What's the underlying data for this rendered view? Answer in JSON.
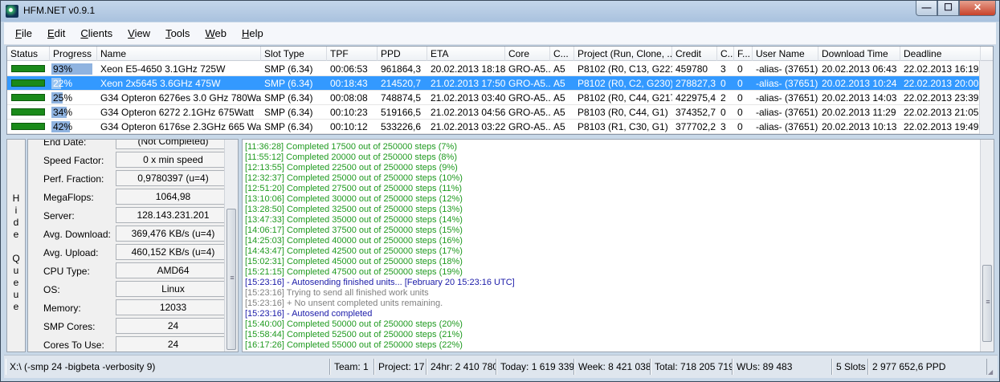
{
  "window": {
    "title": "HFM.NET v0.9.1",
    "min_glyph": "—",
    "max_glyph": "☐",
    "close_glyph": "✕"
  },
  "menu": [
    "File",
    "Edit",
    "Clients",
    "View",
    "Tools",
    "Web",
    "Help"
  ],
  "grid": {
    "columns": [
      "Status",
      "Progress",
      "Name",
      "Slot Type",
      "TPF",
      "PPD",
      "ETA",
      "Core",
      "C...",
      "Project (Run, Clone, ...",
      "Credit",
      "C...",
      "F...",
      "User Name",
      "Download Time",
      "Deadline"
    ],
    "rows": [
      {
        "progress": "93%",
        "progress_value": 0.93,
        "name": "Xeon E5-4650 3.1GHz 725W",
        "slot_type": "SMP (6.34)",
        "tpf": "00:06:53",
        "ppd": "961864,3",
        "eta": "20.02.2013 18:18",
        "core": "GRO-A5...",
        "core_id": "A5",
        "project": "P8102 (R0, C13, G221)",
        "credit": "459780",
        "completed": "3",
        "failed": "0",
        "user": "-alias- (37651)",
        "download": "20.02.2013 06:43",
        "deadline": "22.02.2013 16:19",
        "selected": false
      },
      {
        "progress": "22%",
        "progress_value": 0.22,
        "name": "Xeon 2x5645 3.6GHz 475W",
        "slot_type": "SMP (6.34)",
        "tpf": "00:18:43",
        "ppd": "214520,7",
        "eta": "21.02.2013 17:50",
        "core": "GRO-A5...",
        "core_id": "A5",
        "project": "P8102 (R0, C2, G230)",
        "credit": "278827,3",
        "completed": "0",
        "failed": "0",
        "user": "-alias- (37651)",
        "download": "20.02.2013 10:24",
        "deadline": "22.02.2013 20:00",
        "selected": true
      },
      {
        "progress": "25%",
        "progress_value": 0.25,
        "name": "G34 Opteron 6276es 3.0 GHz 780Watt",
        "slot_type": "SMP (6.34)",
        "tpf": "00:08:08",
        "ppd": "748874,5",
        "eta": "21.02.2013 03:40",
        "core": "GRO-A5...",
        "core_id": "A5",
        "project": "P8102 (R0, C44, G217)",
        "credit": "422975,4",
        "completed": "2",
        "failed": "0",
        "user": "-alias- (37651)",
        "download": "20.02.2013 14:03",
        "deadline": "22.02.2013 23:39",
        "selected": false
      },
      {
        "progress": "34%",
        "progress_value": 0.34,
        "name": "G34 Opteron 6272 2.1GHz 675Watt",
        "slot_type": "SMP (6.34)",
        "tpf": "00:10:23",
        "ppd": "519166,5",
        "eta": "21.02.2013 04:56",
        "core": "GRO-A5...",
        "core_id": "A5",
        "project": "P8103 (R0, C44, G1)",
        "credit": "374352,7",
        "completed": "0",
        "failed": "0",
        "user": "-alias- (37651)",
        "download": "20.02.2013 11:29",
        "deadline": "22.02.2013 21:05",
        "selected": false
      },
      {
        "progress": "42%",
        "progress_value": 0.42,
        "name": "G34 Opteron 6176se 2.3GHz 665 Watt",
        "slot_type": "SMP (6.34)",
        "tpf": "00:10:12",
        "ppd": "533226,6",
        "eta": "21.02.2013 03:22",
        "core": "GRO-A5...",
        "core_id": "A5",
        "project": "P8103 (R1, C30, G1)",
        "credit": "377702,2",
        "completed": "3",
        "failed": "0",
        "user": "-alias- (37651)",
        "download": "20.02.2013 10:13",
        "deadline": "22.02.2013 19:49",
        "selected": false
      }
    ]
  },
  "queue_toggle": {
    "label": "Hide Queue"
  },
  "info": [
    {
      "label": "End Date:",
      "value": "(Not Completed)"
    },
    {
      "label": "Speed Factor:",
      "value": "0 x min speed"
    },
    {
      "label": "Perf. Fraction:",
      "value": "0,9780397 (u=4)"
    },
    {
      "label": "MegaFlops:",
      "value": "1064,98"
    },
    {
      "label": "Server:",
      "value": "128.143.231.201"
    },
    {
      "label": "Avg. Download:",
      "value": "369,476 KB/s (u=4)"
    },
    {
      "label": "Avg. Upload:",
      "value": "460,152 KB/s (u=4)"
    },
    {
      "label": "CPU Type:",
      "value": "AMD64"
    },
    {
      "label": "OS:",
      "value": "Linux"
    },
    {
      "label": "Memory:",
      "value": "12033"
    },
    {
      "label": "SMP Cores:",
      "value": "24"
    },
    {
      "label": "Cores To Use:",
      "value": "24"
    }
  ],
  "log_colors": {
    "green": "#1f9a1f",
    "blue": "#1a1aa8",
    "gray": "#808080"
  },
  "log": [
    {
      "text": "[11:36:28] Completed 17500 out of 250000 steps  (7%)",
      "color": "green"
    },
    {
      "text": "[11:55:12] Completed 20000 out of 250000 steps  (8%)",
      "color": "green"
    },
    {
      "text": "[12:13:55] Completed 22500 out of 250000 steps  (9%)",
      "color": "green"
    },
    {
      "text": "[12:32:37] Completed 25000 out of 250000 steps  (10%)",
      "color": "green"
    },
    {
      "text": "[12:51:20] Completed 27500 out of 250000 steps  (11%)",
      "color": "green"
    },
    {
      "text": "[13:10:06] Completed 30000 out of 250000 steps  (12%)",
      "color": "green"
    },
    {
      "text": "[13:28:50] Completed 32500 out of 250000 steps  (13%)",
      "color": "green"
    },
    {
      "text": "[13:47:33] Completed 35000 out of 250000 steps  (14%)",
      "color": "green"
    },
    {
      "text": "[14:06:17] Completed 37500 out of 250000 steps  (15%)",
      "color": "green"
    },
    {
      "text": "[14:25:03] Completed 40000 out of 250000 steps  (16%)",
      "color": "green"
    },
    {
      "text": "[14:43:47] Completed 42500 out of 250000 steps  (17%)",
      "color": "green"
    },
    {
      "text": "[15:02:31] Completed 45000 out of 250000 steps  (18%)",
      "color": "green"
    },
    {
      "text": "[15:21:15] Completed 47500 out of 250000 steps  (19%)",
      "color": "green"
    },
    {
      "text": "[15:23:16] - Autosending finished units... [February 20 15:23:16 UTC]",
      "color": "blue"
    },
    {
      "text": "[15:23:16] Trying to send all finished work units",
      "color": "gray"
    },
    {
      "text": "[15:23:16] + No unsent completed units remaining.",
      "color": "gray"
    },
    {
      "text": "[15:23:16] - Autosend completed",
      "color": "blue"
    },
    {
      "text": "[15:40:00] Completed 50000 out of 250000 steps  (20%)",
      "color": "green"
    },
    {
      "text": "[15:58:44] Completed 52500 out of 250000 steps  (21%)",
      "color": "green"
    },
    {
      "text": "[16:17:26] Completed 55000 out of 250000 steps  (22%)",
      "color": "green"
    }
  ],
  "statusbar": {
    "args": "X:\\ (-smp 24 -bigbeta -verbosity 9)",
    "team": "Team: 1",
    "project": "Project: 17",
    "h24": "24hr: 2 410 780",
    "today": "Today: 1 619 339",
    "week": "Week: 8 421 038",
    "total": "Total: 718 205 719",
    "wus": "WUs: 89 483",
    "slots": "5 Slots",
    "ppd": "2 977 652,6 PPD"
  }
}
